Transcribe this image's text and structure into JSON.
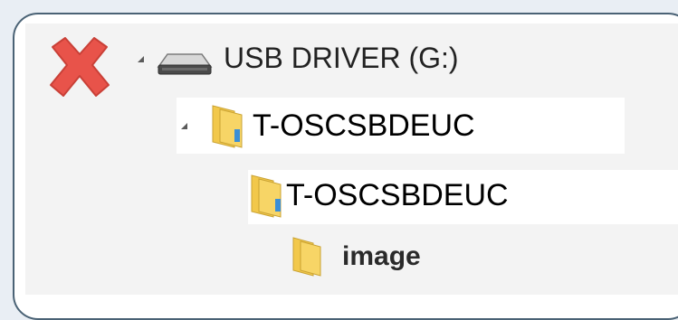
{
  "tree": {
    "items": [
      {
        "label": "USB DRIVER (G:)",
        "icon": "usb-drive-icon",
        "expanded": true
      },
      {
        "label": "T-OSCSBDEUC",
        "icon": "folder-icon",
        "expanded": true
      },
      {
        "label": "T-OSCSBDEUC",
        "icon": "folder-icon"
      },
      {
        "label": "image",
        "icon": "folder-icon"
      }
    ]
  },
  "status_icon": "red-x-icon",
  "colors": {
    "frame_border": "#4a6275",
    "x_mark": "#e8534a",
    "folder": "#f2c84b",
    "folder_accent": "#3b8fd6"
  }
}
